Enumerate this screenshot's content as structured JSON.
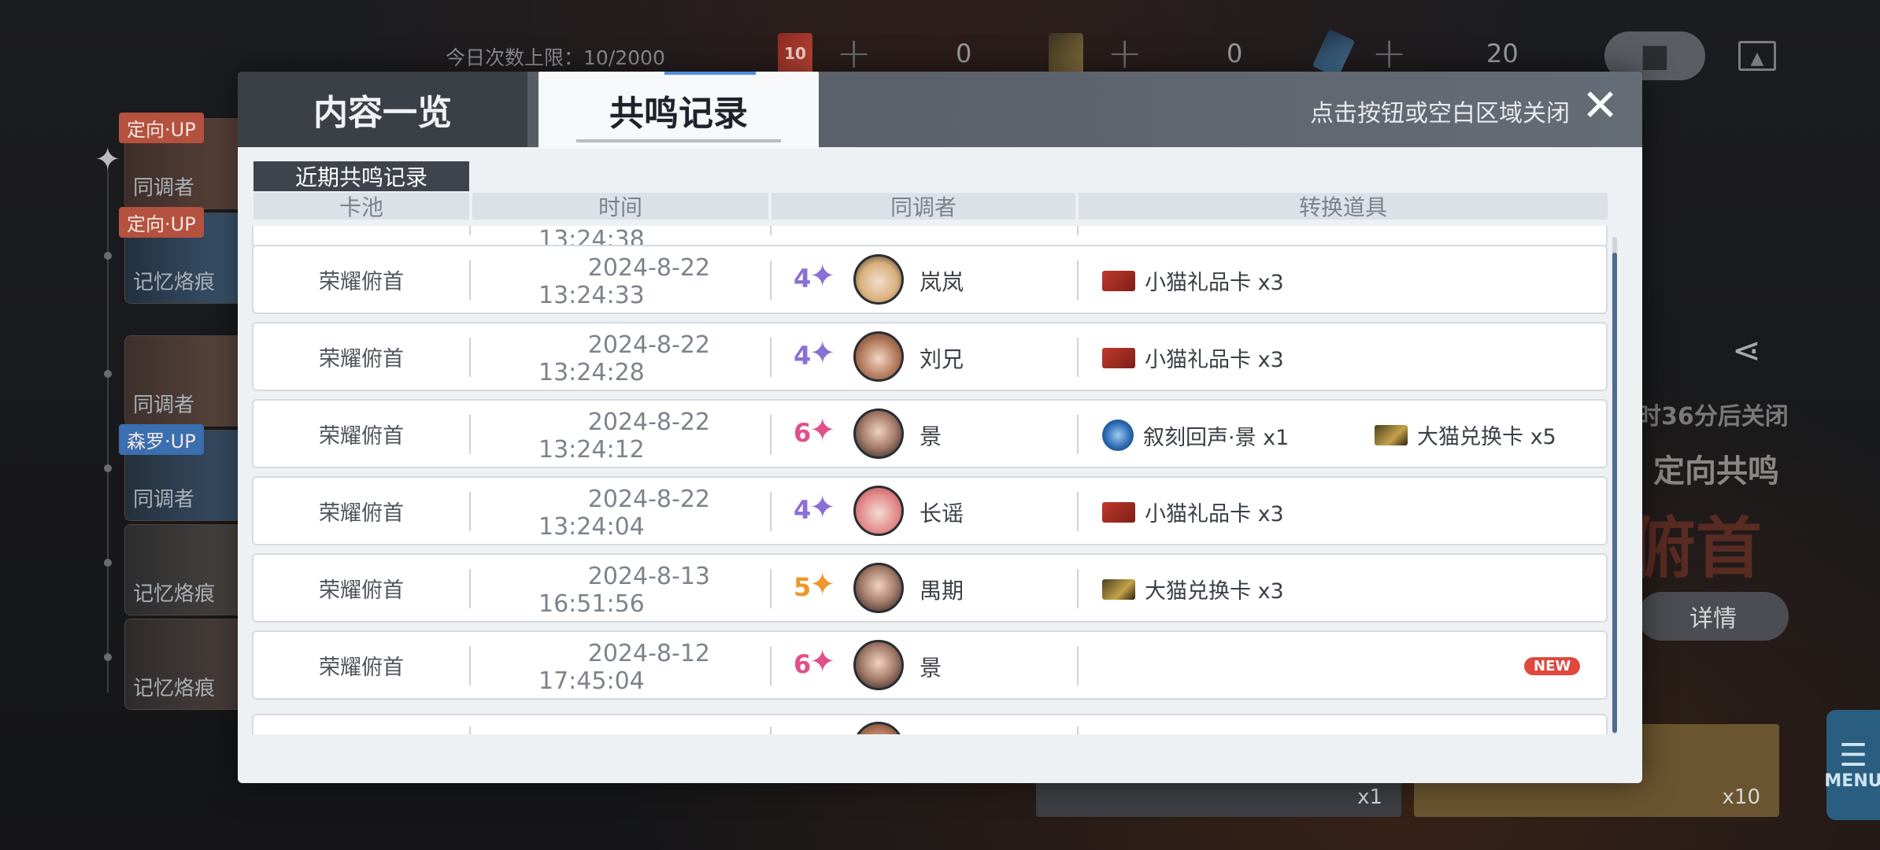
{
  "top_bar": {
    "daily_limit": "今日次数上限：10/2000",
    "currencies": [
      {
        "icon": "ticket-red-icon",
        "ticket_label": "10",
        "amount": "0"
      },
      {
        "icon": "card-gold-icon",
        "ticket_label": "",
        "amount": "0"
      },
      {
        "icon": "crystal-blue-icon",
        "ticket_label": "",
        "amount": "20"
      }
    ]
  },
  "side_banners": [
    {
      "tag": "定向·UP",
      "caption": "同调者"
    },
    {
      "tag": "定向·UP",
      "caption": "记忆烙痕"
    },
    {
      "tag": "",
      "caption": "同调者"
    },
    {
      "tag": "森罗·UP",
      "caption": "同调者"
    },
    {
      "tag": "",
      "caption": "记忆烙痕"
    },
    {
      "tag": "",
      "caption": "记忆烙痕"
    }
  ],
  "behind": {
    "countdown": "时36分后关闭",
    "banner_type": "定向共鸣",
    "banner_name": "俯首",
    "detail_button": "详情",
    "pull_one_count": "x1",
    "pull_ten_count": "x10",
    "menu_label": "MENU"
  },
  "modal": {
    "tabs": {
      "overview": "内容一览",
      "records": "共鸣记录"
    },
    "close_hint": "点击按钮或空白区域关闭",
    "close_symbol": "✕",
    "section_title": "近期共鸣记录",
    "columns": {
      "pool": "卡池",
      "time": "时间",
      "character": "同调者",
      "items": "转换道具"
    },
    "partial_top_time": "13:24:38",
    "rows": [
      {
        "pool": "荣耀俯首",
        "date": "2024-8-22",
        "time": "13:24:33",
        "rarity": "4",
        "name": "岚岚",
        "item1": "小猫礼品卡 x3",
        "item1_icon": "red",
        "item2": "",
        "item2_icon": "",
        "new": ""
      },
      {
        "pool": "荣耀俯首",
        "date": "2024-8-22",
        "time": "13:24:28",
        "rarity": "4",
        "name": "刘兄",
        "item1": "小猫礼品卡 x3",
        "item1_icon": "red",
        "item2": "",
        "item2_icon": "",
        "new": ""
      },
      {
        "pool": "荣耀俯首",
        "date": "2024-8-22",
        "time": "13:24:12",
        "rarity": "6",
        "name": "景",
        "item1": "叙刻回声·景 x1",
        "item1_icon": "blue",
        "item2": "大猫兑换卡 x5",
        "item2_icon": "gold",
        "new": ""
      },
      {
        "pool": "荣耀俯首",
        "date": "2024-8-22",
        "time": "13:24:04",
        "rarity": "4",
        "name": "长谣",
        "item1": "小猫礼品卡 x3",
        "item1_icon": "red",
        "item2": "",
        "item2_icon": "",
        "new": ""
      },
      {
        "pool": "荣耀俯首",
        "date": "2024-8-13",
        "time": "16:51:56",
        "rarity": "5",
        "name": "禺期",
        "item1": "大猫兑换卡 x3",
        "item1_icon": "gold",
        "item2": "",
        "item2_icon": "",
        "new": ""
      },
      {
        "pool": "荣耀俯首",
        "date": "2024-8-12",
        "time": "17:45:04",
        "rarity": "6",
        "name": "景",
        "item1": "",
        "item1_icon": "",
        "item2": "",
        "item2_icon": "",
        "new": "NEW"
      }
    ],
    "rarity_colors": {
      "4": "#8a6fd6",
      "5": "#f0962a",
      "6": "#e0508c"
    }
  }
}
